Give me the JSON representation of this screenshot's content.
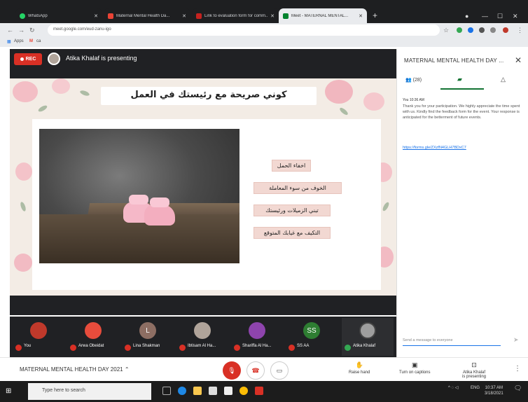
{
  "browser": {
    "tabs": [
      {
        "label": "WhatsApp",
        "color": "#25d366",
        "active": false
      },
      {
        "label": "Maternal Mental Health Da...",
        "color": "#ea4335",
        "active": false
      },
      {
        "label": "Link to evaluation form for comm...",
        "color": "#c5221f",
        "active": false
      },
      {
        "label": "Meet - MATERNAL MENTAL...",
        "color": "#00832d",
        "active": true
      }
    ],
    "new_tab": "+",
    "url": "meet.google.com/eud-zanu-igo",
    "bookmarks": {
      "apps": "Apps",
      "gmail": "M",
      "extra": "ca"
    }
  },
  "meet": {
    "rec_label": "REC",
    "presenting_text": "Atika Khalaf is presenting",
    "slide": {
      "title": "كوني صريحة مع رئيستك في العمل",
      "bullets": [
        "اخفاء الحمل",
        "الخوف من سوء المعاملة",
        "تبني الزميلات ورئيستك",
        "التكيف مع غيابك المتوقع"
      ]
    },
    "participants": [
      {
        "name": "You",
        "initial": "",
        "color": "#c0392b"
      },
      {
        "name": "Arwa Obeidat",
        "initial": "",
        "color": "#c0392b"
      },
      {
        "name": "Lina Shakman",
        "initial": "L",
        "color": "#8d6e63"
      },
      {
        "name": "Ibtisam Al Ha...",
        "initial": "",
        "color": "#b0a49a"
      },
      {
        "name": "Shariffa Al Ha...",
        "initial": "",
        "color": "#8e44ad"
      },
      {
        "name": "SS AA",
        "initial": "SS",
        "color": "#2e7d32"
      },
      {
        "name": "Atika Khalaf",
        "initial": "",
        "color": "#9e9e9e"
      }
    ]
  },
  "panel": {
    "title": "MATERNAL MENTAL HEALTH DAY ...",
    "people_count": "(28)",
    "message": {
      "sender": "You  10:36 AM",
      "text": "Thank you for your participation. We highly appreciate the time spent with us. Kindly find the feedback form for the event. Your response is anticipated for the betterment of future events.",
      "link": "https://forms.gle/ZXzfN4GLH7BDxC7"
    },
    "input_placeholder": "Send a message to everyone"
  },
  "bottom": {
    "meeting_title": "MATERNAL MENTAL HEALTH DAY 2021",
    "raise_hand": "Raise hand",
    "captions": "Turn on captions",
    "presenting_line1": "Atika Khalaf",
    "presenting_line2": "is presenting"
  },
  "taskbar": {
    "search_placeholder": "Type here to search",
    "lang": "ENG",
    "time": "10:37 AM",
    "date": "3/18/2021"
  }
}
